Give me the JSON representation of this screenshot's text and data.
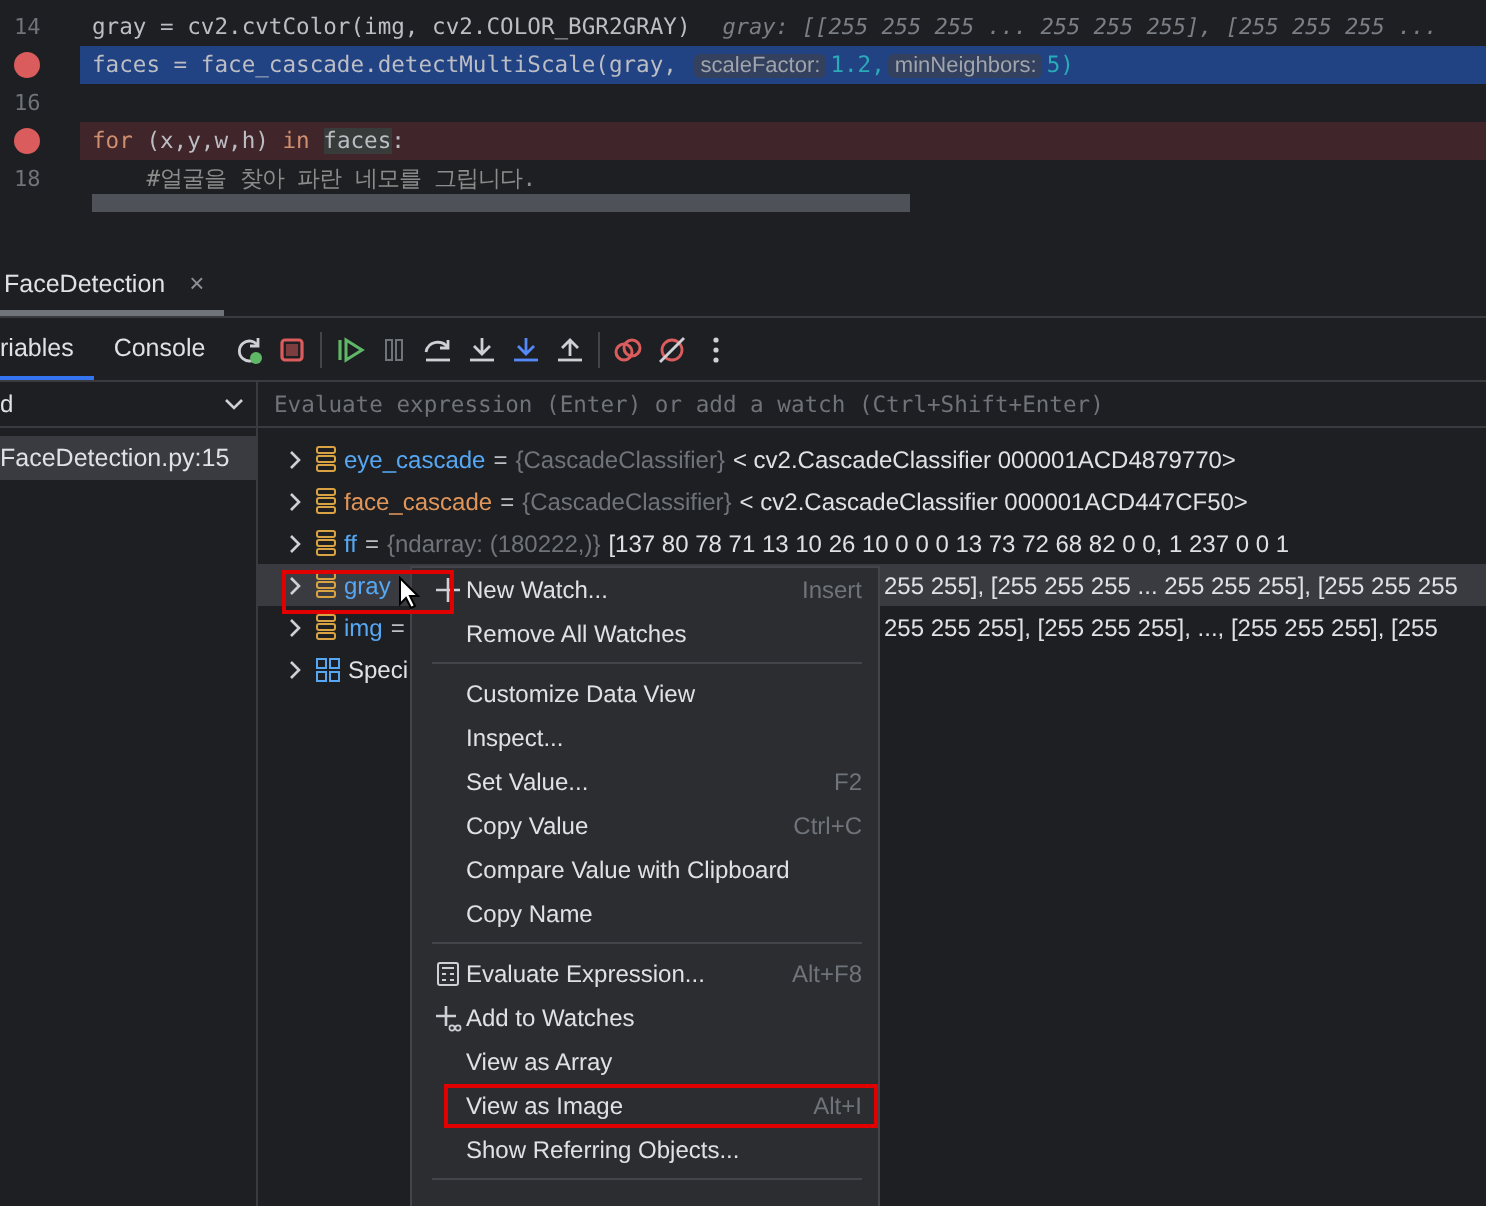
{
  "editor": {
    "lines": [
      {
        "number": "14",
        "breakpoint": false,
        "selected": false,
        "segments": [
          {
            "text": "gray = cv2.cvtColor(img, cv2.COLOR_BGR2GRAY)",
            "kind": "plain"
          },
          {
            "text": "gray: [[255 255 255 ... 255 255 255], [255 255 255 ...",
            "kind": "hint"
          }
        ]
      },
      {
        "breakpoint": true,
        "selected": true,
        "segments": [
          {
            "text": "faces = face_cascade.detectMultiScale(gray, ",
            "kind": "plain"
          },
          {
            "text": "scaleFactor:",
            "kind": "chip"
          },
          {
            "text": "1.2,",
            "kind": "number"
          },
          {
            "text": "minNeighbors:",
            "kind": "chip"
          },
          {
            "text": "5)",
            "kind": "number"
          }
        ]
      },
      {
        "number": "16",
        "breakpoint": false,
        "selected": false
      },
      {
        "breakpoint": true,
        "selected": false,
        "segments": [
          {
            "text": "for",
            "kind": "keyword"
          },
          {
            "text": " (x,y,w,h) ",
            "kind": "plain"
          },
          {
            "text": "in",
            "kind": "keyword"
          },
          {
            "text": "faces",
            "kind": "usage"
          },
          {
            "text": ":",
            "kind": "plain"
          }
        ]
      },
      {
        "number": "18",
        "breakpoint": false,
        "selected": false,
        "segments": [
          {
            "text": "    #얼굴을 찾아 파란 네모를 그립니다.",
            "kind": "comment"
          }
        ]
      }
    ]
  },
  "debug_tabs": [
    {
      "label": "FaceDetection",
      "selected": true,
      "close": "×"
    }
  ],
  "panel_tabs": [
    {
      "label": "riables",
      "selected": true
    },
    {
      "label": "Console",
      "selected": false
    }
  ],
  "thread_dropdown": {
    "value": "d"
  },
  "frames": [
    {
      "label": "FaceDetection.py:15",
      "selected": true
    }
  ],
  "watch_field": {
    "placeholder": "Evaluate expression (Enter) or add a watch (Ctrl+Shift+Enter)"
  },
  "variables": [
    {
      "kind": "object",
      "name": "eye_cascade",
      "changed": false,
      "selected": false,
      "highlighted": false,
      "separator": "=",
      "type": "{CascadeClassifier}",
      "value": "< cv2.CascadeClassifier 000001ACD4879770>"
    },
    {
      "kind": "object",
      "name": "face_cascade",
      "changed": true,
      "selected": false,
      "highlighted": false,
      "separator": "=",
      "type": "{CascadeClassifier}",
      "value": "< cv2.CascadeClassifier 000001ACD447CF50>"
    },
    {
      "kind": "object",
      "name": "ff",
      "changed": false,
      "selected": false,
      "highlighted": false,
      "separator": "=",
      "type": "{ndarray: (180222,)}",
      "value": "[137  80  78  71  13  10  26  10   0   0   0  13  73  72  68  82   0   0,   1 237   0   0  1"
    },
    {
      "kind": "object",
      "name": "gray",
      "changed": false,
      "selected": true,
      "highlighted": true,
      "tail": "255 255], [255 255 255 ... 255 255 255], [255 255 255"
    },
    {
      "kind": "object",
      "name": "img",
      "changed": false,
      "selected": false,
      "highlighted": false,
      "separator": "=",
      "tail": "255 255 255],  [255 255 255],  ...,  [255 255 255],  [255"
    },
    {
      "kind": "special",
      "name": "Speci",
      "selected": false,
      "highlighted": false
    }
  ],
  "context_menu": {
    "items": [
      {
        "kind": "new",
        "label": "New Watch...",
        "shortcut": "Insert",
        "highlighted": false
      },
      {
        "kind": "item",
        "label": "Remove All Watches",
        "highlighted": false
      },
      {
        "kind": "separator"
      },
      {
        "kind": "item",
        "label": "Customize Data View",
        "highlighted": false
      },
      {
        "kind": "item",
        "label": "Inspect...",
        "highlighted": false
      },
      {
        "kind": "item",
        "label": "Set Value...",
        "shortcut": "F2",
        "highlighted": false
      },
      {
        "kind": "item",
        "label": "Copy Value",
        "shortcut": "Ctrl+C",
        "highlighted": false
      },
      {
        "kind": "item",
        "label": "Compare Value with Clipboard",
        "highlighted": false
      },
      {
        "kind": "item",
        "label": "Copy Name",
        "highlighted": false
      },
      {
        "kind": "separator"
      },
      {
        "kind": "evaluate",
        "label": "Evaluate Expression...",
        "shortcut": "Alt+F8",
        "highlighted": false
      },
      {
        "kind": "add",
        "label": "Add to Watches",
        "highlighted": false
      },
      {
        "kind": "item",
        "label": "View as Array",
        "highlighted": false
      },
      {
        "kind": "item",
        "label": "View as Image",
        "shortcut": "Alt+I",
        "highlighted": true
      },
      {
        "kind": "item",
        "label": "Show Referring Objects...",
        "highlighted": false
      },
      {
        "kind": "separator"
      }
    ]
  }
}
